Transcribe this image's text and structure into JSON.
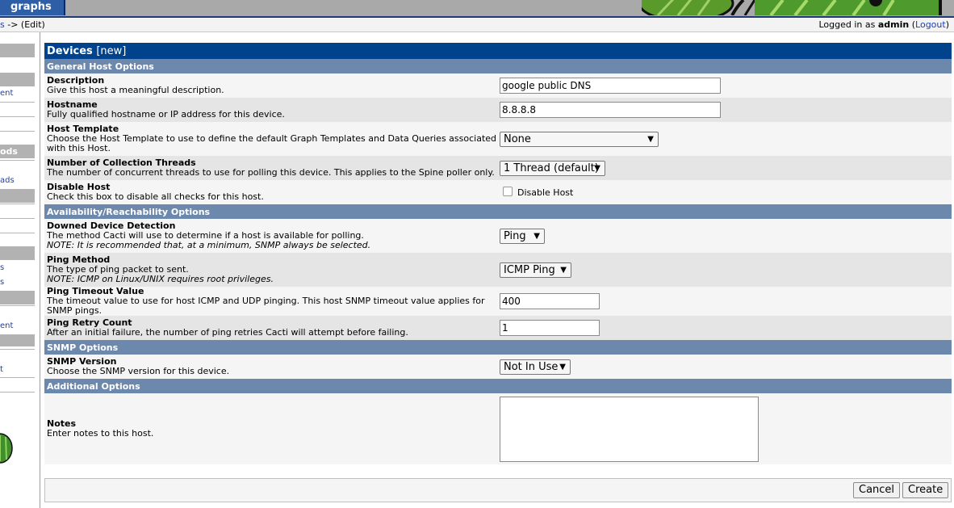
{
  "top_tab": {
    "label": "graphs"
  },
  "breadcrumb": {
    "link": "s",
    "rest": " -> (Edit)"
  },
  "login": {
    "prefix": "Logged in as ",
    "user": "admin",
    "logout": "Logout"
  },
  "sidebar": {
    "headers": [
      "",
      "",
      "ods",
      "",
      "",
      ""
    ],
    "links": [
      "ent",
      "ads",
      "s",
      "s",
      "ent",
      "t"
    ]
  },
  "form": {
    "title": "Devices",
    "title_suffix": "[new]",
    "sections": {
      "general": "General Host Options",
      "availability": "Availability/Reachability Options",
      "snmp": "SNMP Options",
      "additional": "Additional Options"
    },
    "fields": {
      "description": {
        "name": "Description",
        "help": "Give this host a meaningful description.",
        "value": "google public DNS"
      },
      "hostname": {
        "name": "Hostname",
        "help": "Fully qualified hostname or IP address for this device.",
        "value": "8.8.8.8"
      },
      "host_template": {
        "name": "Host Template",
        "help": "Choose the Host Template to use to define the default Graph Templates and Data Queries associated with this Host.",
        "value": "None"
      },
      "threads": {
        "name": "Number of Collection Threads",
        "help": "The number of concurrent threads to use for polling this device. This applies to the Spine poller only.",
        "value": "1 Thread (default)"
      },
      "disable_host": {
        "name": "Disable Host",
        "help": "Check this box to disable all checks for this host.",
        "checkbox_label": "Disable Host",
        "checked": false
      },
      "downed_detection": {
        "name": "Downed Device Detection",
        "help": "The method Cacti will use to determine if a host is available for polling.",
        "note": "NOTE: It is recommended that, at a minimum, SNMP always be selected.",
        "value": "Ping"
      },
      "ping_method": {
        "name": "Ping Method",
        "help": "The type of ping packet to sent.",
        "note": "NOTE: ICMP on Linux/UNIX requires root privileges.",
        "value": "ICMP Ping"
      },
      "ping_timeout": {
        "name": "Ping Timeout Value",
        "help": "The timeout value to use for host ICMP and UDP pinging. This host SNMP timeout value applies for SNMP pings.",
        "value": "400"
      },
      "ping_retry": {
        "name": "Ping Retry Count",
        "help": "After an initial failure, the number of ping retries Cacti will attempt before failing.",
        "value": "1"
      },
      "snmp_version": {
        "name": "SNMP Version",
        "help": "Choose the SNMP version for this device.",
        "value": "Not In Use"
      },
      "notes": {
        "name": "Notes",
        "help": "Enter notes to this host.",
        "value": ""
      }
    }
  },
  "buttons": {
    "cancel": "Cancel",
    "create": "Create"
  },
  "colors": {
    "title_bg": "#00438c",
    "section_bg": "#6d88ad",
    "row_odd": "#f5f5f5",
    "row_even": "#e5e5e5",
    "link": "#1b3fb5"
  }
}
